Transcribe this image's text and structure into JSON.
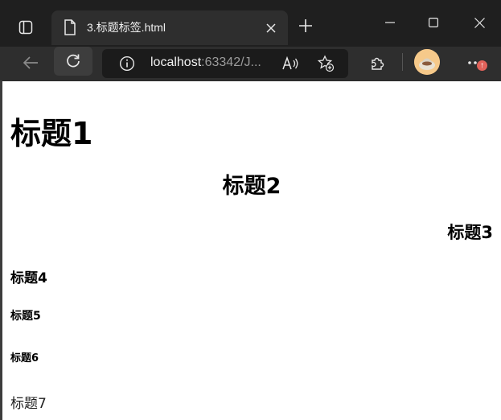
{
  "browser": {
    "tab": {
      "title": "3.标题标签.html"
    },
    "address_bar": {
      "host": "localhost",
      "rest": ":63342/J..."
    }
  },
  "page": {
    "headings": {
      "h1": "标题1",
      "h2": "标题2",
      "h3": "标题3",
      "h4": "标题4",
      "h5": "标题5",
      "h6": "标题6"
    },
    "text7": "标题7"
  }
}
